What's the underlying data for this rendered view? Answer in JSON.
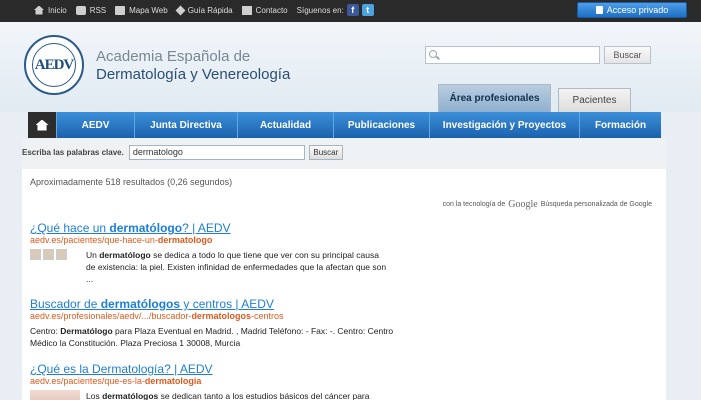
{
  "topbar": {
    "links": [
      {
        "icon": "home-icon",
        "label": "Inicio"
      },
      {
        "icon": "rss-icon",
        "label": "RSS"
      },
      {
        "icon": "map-icon",
        "label": "Mapa Web"
      },
      {
        "icon": "guide-icon",
        "label": "Guía Rápida"
      },
      {
        "icon": "mail-icon",
        "label": "Contacto"
      }
    ],
    "follow_label": "Síguenos en:",
    "facebook": "f",
    "twitter": "t",
    "private_access": "Acceso privado"
  },
  "header": {
    "logo_text": "AEDV",
    "org_line1": "Academia Española de",
    "org_line2": "Dermatología y Venereología",
    "search_placeholder": "",
    "search_button": "Buscar",
    "tabs": [
      {
        "label": "Área profesionales",
        "active": true
      },
      {
        "label": "Pacientes",
        "active": false
      }
    ]
  },
  "nav": {
    "items": [
      "AEDV",
      "Junta Directiva",
      "Actualidad",
      "Publicaciones",
      "Investigación y Proyectos",
      "Formación"
    ]
  },
  "query": {
    "label": "Escriba las palabras clave.",
    "value": "dermatologo",
    "button": "Buscar"
  },
  "results": {
    "count_text": "Aproximadamente 518 resultados (0,26 segundos)",
    "powered_prefix": "con la tecnología de",
    "powered_brand": "Google",
    "powered_suffix": "Búsqueda personalizada de Google",
    "items": [
      {
        "title_pre": "¿Qué hace un ",
        "title_bold": "dermatólogo",
        "title_post": "? | AEDV",
        "url_pre": "aedv.es/pacientes/que-hace-un-",
        "url_bold": "dermatologo",
        "snippet_bold": "dermatólogo",
        "snippet_pre": "Un ",
        "snippet_post": " se dedica a todo lo que tiene que ver con su principal causa de existencia: la piel. Existen infinidad de enfermedades que la afectan que son ..."
      },
      {
        "title_pre": "Buscador de ",
        "title_bold": "dermatólogos",
        "title_post": " y centros | AEDV",
        "url_pre": "aedv.es/profesionales/aedv/.../buscador-",
        "url_bold": "dermatologos",
        "url_post": "-centros",
        "snippet_pre": "Centro: ",
        "snippet_bold": "Dermatólogo",
        "snippet_post": " para Plaza Eventual en Madrid. , Madrid Teléfono: - Fax: -. Centro: Centro Médico la Constitución. Plaza Preciosa 1 30008, Murcia"
      },
      {
        "title_pre": "¿Qué es la Dermatología? | AEDV",
        "url_pre": "aedv.es/pacientes/que-es-la-",
        "url_bold": "dermatologia",
        "snippet_pre": "Los ",
        "snippet_bold": "dermatólogos",
        "snippet_post": " se dedican tanto a los estudios básicos del cáncer para"
      }
    ]
  }
}
